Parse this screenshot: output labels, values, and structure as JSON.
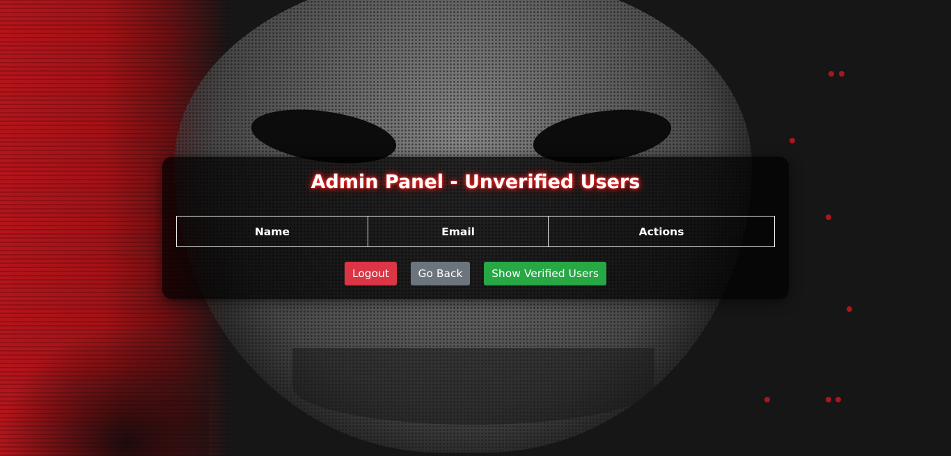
{
  "panel": {
    "title": "Admin Panel - Unverified Users"
  },
  "table": {
    "columns": [
      "Name",
      "Email",
      "Actions"
    ],
    "rows": []
  },
  "actions": {
    "logout_label": "Logout",
    "go_back_label": "Go Back",
    "show_verified_label": "Show Verified Users"
  },
  "colors": {
    "logout": "#dc3545",
    "go_back": "#6c757d",
    "show_verified": "#28a745",
    "title_glow": "#ff2a2a",
    "background_red": "#b3151b"
  }
}
